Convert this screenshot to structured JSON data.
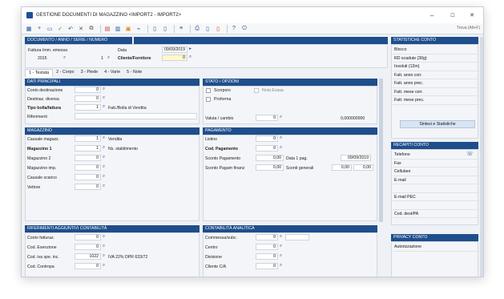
{
  "window": {
    "title": "GESTIONE DOCUMENTI DI MAGAZZINO <IMPORT2 - IMPORT2>",
    "minimize": "–",
    "maximize": "☐",
    "close": "✕"
  },
  "toolbar": {
    "trova": "Trova (Alt+F)"
  },
  "header": {
    "section": "DOCUMENTO / ANNO / SERIE / NUMERO",
    "doc_type": "Fattura Imm. emessa",
    "year": "2015",
    "number": "1",
    "data_label": "Data",
    "data_value": "09/09/2019",
    "cliente_label": "Cliente/Fornitore",
    "cliente_value": "0"
  },
  "tabs": [
    "1 - Testata",
    "2 - Corpo",
    "3 - Piede",
    "4 - Varie",
    "5 - Note"
  ],
  "dati": {
    "title": "DATI PRINCIPALI",
    "rows": [
      {
        "label": "Conto destinazione",
        "value": "0",
        "desc": ""
      },
      {
        "label": "Destinaz. diversa",
        "value": "0",
        "desc": ""
      },
      {
        "label": "Tipo bolla/fattura",
        "value": "1",
        "desc": "Fatt./Bolla di Vendita"
      },
      {
        "label": "Riferimenti",
        "value": "",
        "desc": ""
      }
    ]
  },
  "stato": {
    "title": "STATO / OPZIONI",
    "scorporo": "Scorporo",
    "proforma": "Proforma",
    "nota": "Nota Evasa",
    "valuta_label": "Valuta / cambio",
    "valuta_value": "0",
    "cambio_value": "0,000000000"
  },
  "magazzino": {
    "title": "MAGAZZINO",
    "rows": [
      {
        "label": "Causale magazz.",
        "value": "1",
        "desc": "Vendita"
      },
      {
        "label": "Magazzino 1",
        "value": "1",
        "desc": "Ns. stabilimento"
      },
      {
        "label": "Magazzino 2",
        "value": "0",
        "desc": ""
      },
      {
        "label": "Magazzino imp.",
        "value": "0",
        "desc": ""
      },
      {
        "label": "Causale scarico",
        "value": "0",
        "desc": ""
      },
      {
        "label": "Vettore",
        "value": "0",
        "desc": ""
      }
    ]
  },
  "pagamento": {
    "title": "PAGAMENTO",
    "listino_label": "Listino",
    "listino_value": "0",
    "cod_label": "Cod. Pagamento",
    "cod_value": "0",
    "sconto_label": "Sconto Pagamento",
    "sconto_value": "0,00",
    "data1_label": "Data 1 pag.",
    "data1_value": "09/09/2019",
    "sconto_fin_label": "Sconto Pagam finanz",
    "sconto_fin_value": "0,00",
    "sconti_gen_label": "Sconti generali",
    "sconti_gen_1": "0,00",
    "sconti_gen_2": "0,00"
  },
  "contab": {
    "title": "RIFERIMENTI AGGIUNTIVI CONTABILITÀ",
    "rows": [
      {
        "label": "Conto fatturaz.",
        "value": "0",
        "desc": ""
      },
      {
        "label": "Cod. Esenzione",
        "value": "0",
        "desc": ""
      },
      {
        "label": "Cod. iva spe. inc.",
        "value": "1022",
        "desc": "IVA 22% DPR 633/72"
      },
      {
        "label": "Cod. Contropa",
        "value": "0",
        "desc": ""
      }
    ]
  },
  "analitica": {
    "title": "CONTABILITÀ ANALITICA",
    "rows": [
      {
        "label": "Commessa/subc.",
        "value": "0"
      },
      {
        "label": "Centro",
        "value": "0"
      },
      {
        "label": "Divisione",
        "value": "0"
      },
      {
        "label": "Cliente C/A",
        "value": "0"
      }
    ]
  },
  "statistiche": {
    "title": "STATISTICHE CONTO",
    "items": [
      "Blocco",
      "RD scadute (30g)",
      "Insoluti (12m)",
      "Fatt. anno corr.",
      "Fatt. anno prec.",
      "Fatt. mese corr.",
      "Fatt. mese prec."
    ],
    "button": "Sintesi e Statistiche"
  },
  "recapiti": {
    "title": "RECAPITI CONTO",
    "items": [
      "Telefono",
      "Fax",
      "Cellulare",
      "E-mail",
      "",
      "E-mail PEC",
      "",
      "Cod. dest/PA"
    ]
  },
  "privacy": {
    "title": "PRIVACY CONTO",
    "items": [
      "Autorizzazione"
    ]
  }
}
